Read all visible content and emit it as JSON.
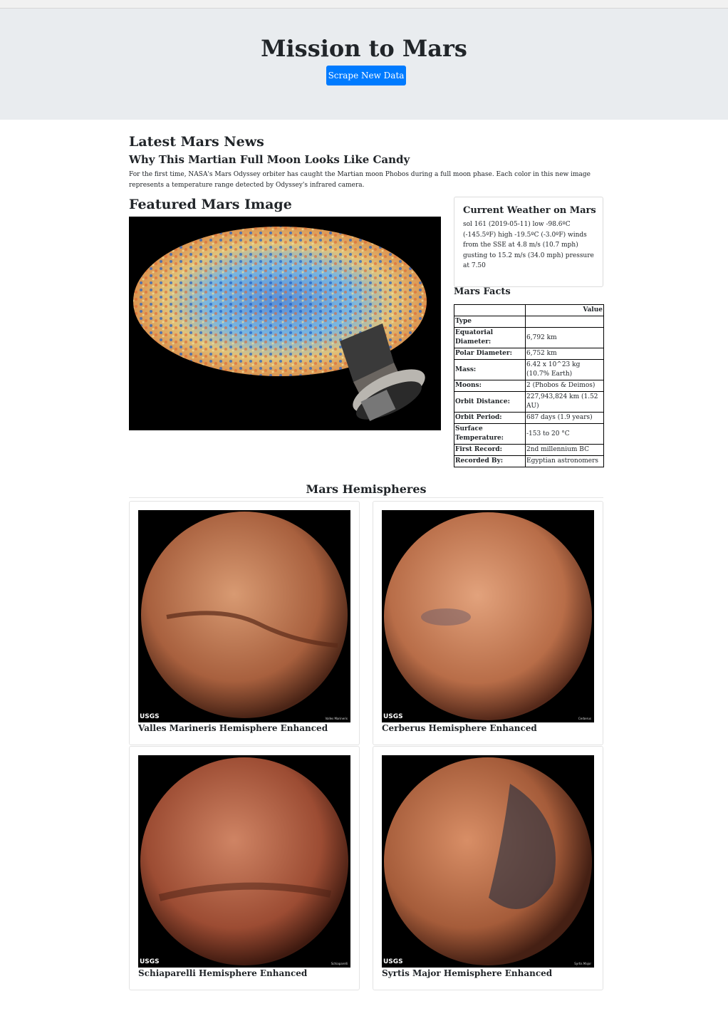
{
  "header": {
    "title": "Mission to Mars",
    "scrape_button": "Scrape New Data"
  },
  "news": {
    "heading": "Latest Mars News",
    "title": "Why This Martian Full Moon Looks Like Candy",
    "paragraph": "For the first time, NASA's Mars Odyssey orbiter has caught the Martian moon Phobos during a full moon phase. Each color in this new image represents a temperature range detected by Odyssey's infrared camera."
  },
  "featured": {
    "heading": "Featured Mars Image"
  },
  "weather": {
    "heading": "Current Weather on Mars",
    "text": "sol 161 (2019-05-11) low -98.6ºC (-145.5ºF) high -19.5ºC (-3.0ºF) winds from the SSE at 4.8 m/s (10.7 mph) gusting to 15.2 m/s (34.0 mph) pressure at 7.50"
  },
  "facts": {
    "heading": "Mars Facts",
    "col_header": "Value",
    "type_label": "Type",
    "rows": [
      {
        "label": "Equatorial Diameter:",
        "value": "6,792 km"
      },
      {
        "label": "Polar Diameter:",
        "value": "6,752 km"
      },
      {
        "label": "Mass:",
        "value": "6.42 x 10^23 kg (10.7% Earth)"
      },
      {
        "label": "Moons:",
        "value": "2 (Phobos & Deimos)"
      },
      {
        "label": "Orbit Distance:",
        "value": "227,943,824 km (1.52 AU)"
      },
      {
        "label": "Orbit Period:",
        "value": "687 days (1.9 years)"
      },
      {
        "label": "Surface Temperature:",
        "value": "-153 to 20 °C"
      },
      {
        "label": "First Record:",
        "value": "2nd millennium BC"
      },
      {
        "label": "Recorded By:",
        "value": "Egyptian astronomers"
      }
    ]
  },
  "hemispheres": {
    "heading": "Mars Hemispheres",
    "usgs": "USGS",
    "items": [
      {
        "title": "Valles Marineris Hemisphere Enhanced",
        "label": "Valles Marineris",
        "color": "#b5734f"
      },
      {
        "title": "Cerberus Hemisphere Enhanced",
        "label": "Cerberus",
        "color": "#c37c58"
      },
      {
        "title": "Schiaparelli Hemisphere Enhanced",
        "label": "Schiaparelli",
        "color": "#a8583f"
      },
      {
        "title": "Syrtis Major Hemisphere Enhanced",
        "label": "Syrtis Major",
        "color": "#b06a47"
      }
    ]
  }
}
